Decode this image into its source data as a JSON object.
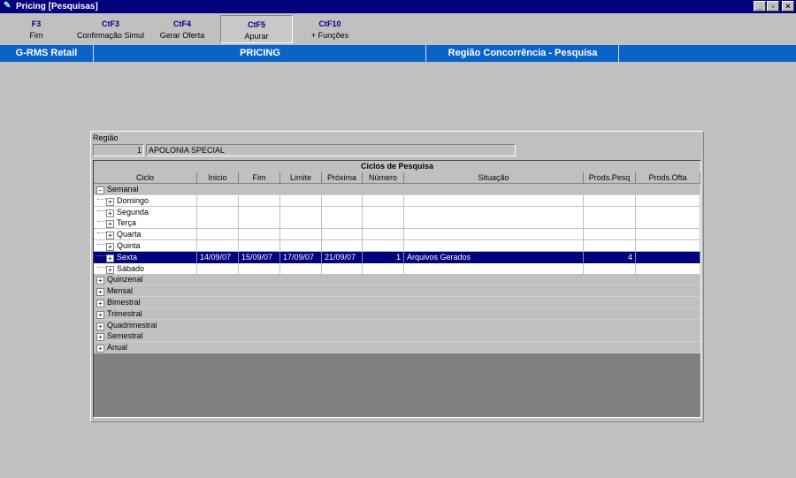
{
  "window": {
    "title": "Pricing [Pesquisas]"
  },
  "toolbar": [
    {
      "key": "F3",
      "label": "Fim"
    },
    {
      "key": "CtF3",
      "label": "Confirmação Simul"
    },
    {
      "key": "CtF4",
      "label": "Gerar Oferta"
    },
    {
      "key": "CtF5",
      "label": "Apurar"
    },
    {
      "key": "CtF10",
      "label": "+ Funções"
    }
  ],
  "banner": {
    "app": "G-RMS Retail",
    "module": "PRICING",
    "screen": "Região Concorrência - Pesquisa"
  },
  "region": {
    "label": "Região",
    "code": "1",
    "name": "APOLONIA SPECIAL"
  },
  "grid": {
    "title": "Ciclos de Pesquisa",
    "columns": [
      "Ciclo",
      "Inicio",
      "Fim",
      "Limite",
      "Próxima",
      "Número",
      "Situação",
      "Prods.Pesq",
      "Prods.Ofta"
    ],
    "rows": [
      {
        "label": "Semanal",
        "level": 0,
        "expander": "−"
      },
      {
        "label": "Domingo",
        "level": 1,
        "expander": "+"
      },
      {
        "label": "Segunda",
        "level": 1,
        "expander": "+"
      },
      {
        "label": "Terça",
        "level": 1,
        "expander": "+"
      },
      {
        "label": "Quarta",
        "level": 1,
        "expander": "+"
      },
      {
        "label": "Quinta",
        "level": 1,
        "expander": "+"
      },
      {
        "label": "Sexta",
        "level": 1,
        "expander": "+",
        "selected": true,
        "inicio": "14/09/07",
        "fim": "15/09/07",
        "limite": "17/09/07",
        "proxima": "21/09/07",
        "numero": "1",
        "situacao": "Arquivos Gerados",
        "prods_pesq": "4",
        "prods_ofta": ""
      },
      {
        "label": "Sábado",
        "level": 1,
        "expander": "+"
      },
      {
        "label": "Quinzenal",
        "level": 0,
        "expander": "+"
      },
      {
        "label": "Mensal",
        "level": 0,
        "expander": "+"
      },
      {
        "label": "Bimestral",
        "level": 0,
        "expander": "+"
      },
      {
        "label": "Trimestral",
        "level": 0,
        "expander": "+"
      },
      {
        "label": "Quadrimestral",
        "level": 0,
        "expander": "+"
      },
      {
        "label": "Semestral",
        "level": 0,
        "expander": "+"
      },
      {
        "label": "Anual",
        "level": 0,
        "expander": "+"
      }
    ]
  }
}
